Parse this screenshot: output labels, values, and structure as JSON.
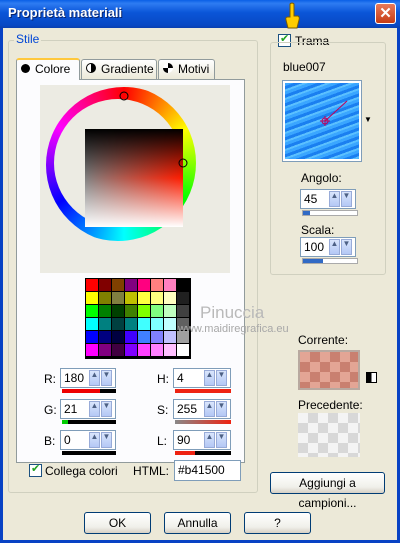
{
  "window": {
    "title": "Proprietà materiali",
    "close_glyph": "✕"
  },
  "left_group": {
    "legend": "Stile"
  },
  "tabs": [
    {
      "label": "Colore",
      "icon": "filled-circle-icon"
    },
    {
      "label": "Gradiente",
      "icon": "half-circle-icon"
    },
    {
      "label": "Motivi",
      "icon": "pattern-icon"
    }
  ],
  "selected_color": "#b41500",
  "rgb": {
    "r_label": "R:",
    "r": "180",
    "g_label": "G:",
    "g": "21",
    "b_label": "B:",
    "b": "0"
  },
  "hsl": {
    "h_label": "H:",
    "h": "4",
    "s_label": "S:",
    "s": "255",
    "l_label": "L:",
    "l": "90"
  },
  "collega": {
    "label": "Collega colori",
    "checked": true
  },
  "html_field": {
    "label": "HTML:",
    "value": "#b41500"
  },
  "trama": {
    "label": "Trama",
    "checked": true,
    "pattern_name": "blue007",
    "angle_label": "Angolo:",
    "angle": "45",
    "scale_label": "Scala:",
    "scale": "100"
  },
  "corrente": {
    "label": "Corrente:"
  },
  "precedente": {
    "label": "Precedente:"
  },
  "watermark": {
    "line1": "Pinuccia",
    "line2": "www.maidiregrafica.eu"
  },
  "buttons": {
    "add_swatch": "Aggiungi a campioni...",
    "ok": "OK",
    "cancel": "Annulla",
    "help": "?"
  },
  "palette_colors": [
    [
      "#ff0000",
      "#800000",
      "#804000",
      "#800080",
      "#ff0080",
      "#ff8080",
      "#ff80c0",
      "#000000"
    ],
    [
      "#ffff00",
      "#808000",
      "#808040",
      "#c0c000",
      "#ffff40",
      "#ffff80",
      "#ffffc0",
      "#202020"
    ],
    [
      "#00ff00",
      "#008000",
      "#004000",
      "#408000",
      "#80ff00",
      "#80ff80",
      "#c0ffc0",
      "#404040"
    ],
    [
      "#00ffff",
      "#008080",
      "#004040",
      "#008080",
      "#40ffff",
      "#80ffff",
      "#c0ffff",
      "#606060"
    ],
    [
      "#0000ff",
      "#000080",
      "#000040",
      "#4000ff",
      "#4080ff",
      "#8080ff",
      "#c0c0ff",
      "#a0a0a0"
    ],
    [
      "#ff00ff",
      "#800080",
      "#400040",
      "#8000ff",
      "#ff40ff",
      "#ff80ff",
      "#ffc0ff",
      "#ffffff"
    ]
  ]
}
